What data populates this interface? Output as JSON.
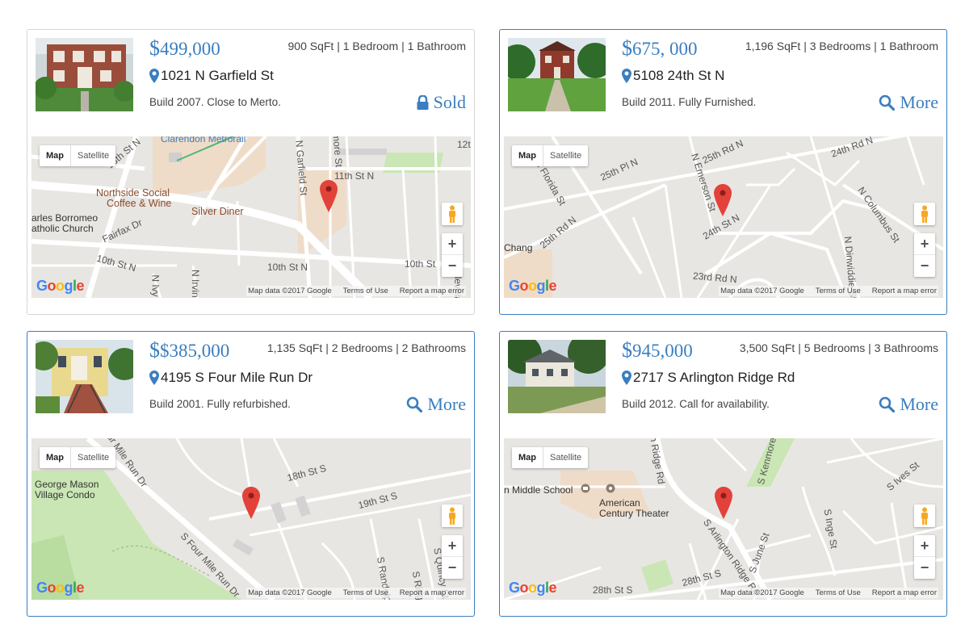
{
  "colors": {
    "accent": "#3a7ebf",
    "map_bg": "#e8e6e2",
    "road": "#ffffff",
    "park": "#c9e6b4",
    "pin": "#e2423a"
  },
  "listings": [
    {
      "price_symbol": "$",
      "price": "499,000",
      "specs": "900 SqFt | 1 Bedroom | 1 Bathroom",
      "address": "1021 N Garfield St",
      "description": "Build 2007. Close to Merto.",
      "action_icon": "lock-icon",
      "action_label": "Sold",
      "map": {
        "map_label": "Map",
        "satellite_label": "Satellite",
        "footer_data": "Map data ©2017 Google",
        "footer_terms": "Terms of Use",
        "footer_report": "Report a map error",
        "labels": [
          "Clarendon Metrorail",
          "13th St N",
          "N Garfield St",
          "11th St N",
          "Northside Social",
          "Coffee & Wine",
          "Silver Diner",
          "arles Borromeo",
          "atholic Church",
          "Fairfax Dr",
          "10th St N",
          "10th St N",
          "10th St",
          "N Ivy",
          "N Irving St",
          "12t",
          "N Cleveland St",
          "more St"
        ]
      }
    },
    {
      "price_symbol": "$",
      "price": "675, 000",
      "specs": "1,196 SqFt | 3 Bedrooms | 1 Bathroom",
      "address": "5108 24th St N",
      "description": "Build 2011. Fully Furnished.",
      "action_icon": "search-icon",
      "action_label": "More",
      "map": {
        "map_label": "Map",
        "satellite_label": "Satellite",
        "footer_data": "Map data ©2017 Google",
        "footer_terms": "Terms of Use",
        "footer_report": "Report a map error",
        "labels": [
          "25th Pl N",
          "25th Rd N",
          "24th Rd N",
          "N Florida St",
          "N Emerson St",
          "N Columbus St",
          "24th St N",
          "25th Rd N",
          "N Dinwiddie St",
          "23rd Rd N",
          "Chang"
        ]
      }
    },
    {
      "price_symbol": "$",
      "price": "$385,000",
      "specs": "1,135 SqFt | 2 Bedrooms | 2 Bathrooms",
      "address": "4195 S Four Mile Run Dr",
      "description": "Build 2001. Fully refurbished.",
      "action_icon": "search-icon",
      "action_label": "More",
      "map": {
        "map_label": "Map",
        "satellite_label": "Satellite",
        "footer_data": "Map data ©2017 Google",
        "footer_terms": "Terms of Use",
        "footer_report": "Report a map error",
        "labels": [
          "S Four Mile Run Dr",
          "George Mason",
          "Village Condo",
          "18th St S",
          "19th St S",
          "S Four Mile Run Dr",
          "S Quincy St",
          "S Randolph St",
          "S Ridge St"
        ]
      }
    },
    {
      "price_symbol": "$",
      "price": "945,000",
      "specs": "3,500 SqFt | 5 Bedrooms | 3 Bathrooms",
      "address": "2717 S Arlington Ridge Rd",
      "description": "Build 2012. Call for availability.",
      "action_icon": "search-icon",
      "action_label": "More",
      "map": {
        "map_label": "Map",
        "satellite_label": "Satellite",
        "footer_data": "Map data ©2017 Google",
        "footer_terms": "Terms of Use",
        "footer_report": "Report a map error",
        "labels": [
          "n Middle School",
          "American",
          "Century Theater",
          "S Arlington Ridge Rd",
          "S June St",
          "28th St S",
          "28th St S",
          "S Ives St",
          "S Kenmore St",
          "S Inge St",
          "n Ridge Rd"
        ]
      }
    }
  ]
}
